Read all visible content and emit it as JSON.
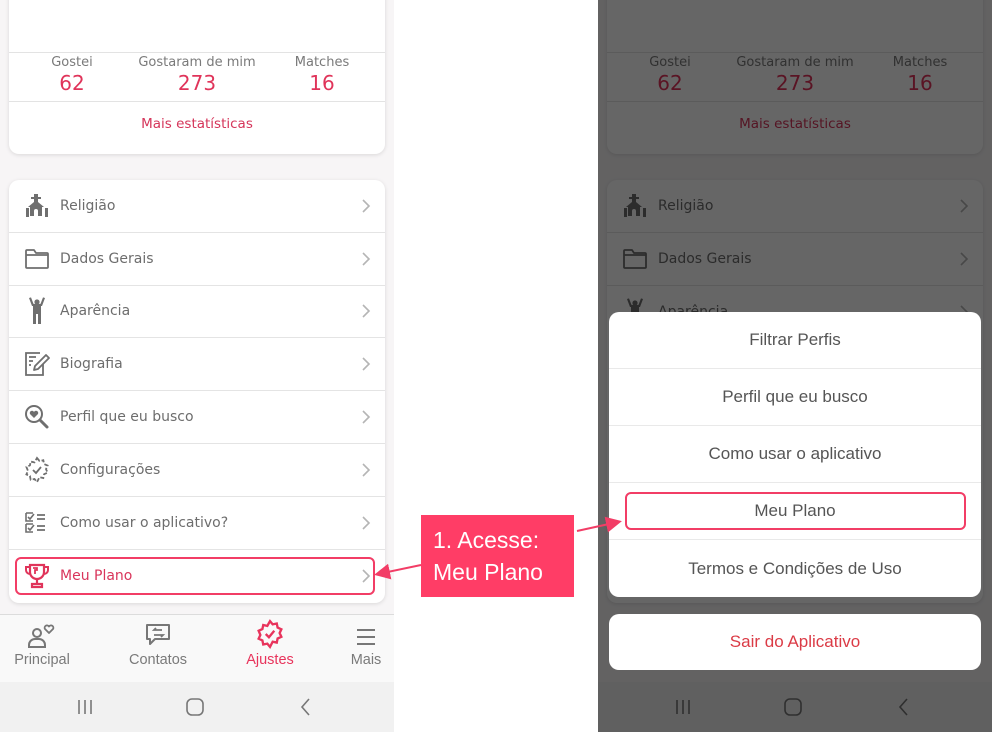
{
  "stats": {
    "items": [
      {
        "label": "Gostei",
        "value": "62"
      },
      {
        "label": "Gostaram de mim",
        "value": "273"
      },
      {
        "label": "Matches",
        "value": "16"
      }
    ],
    "more_link": "Mais estatísticas"
  },
  "settings_menu": {
    "items": [
      {
        "label": "Religião",
        "icon": "church-icon"
      },
      {
        "label": "Dados Gerais",
        "icon": "folder-icon"
      },
      {
        "label": "Aparência",
        "icon": "person-icon"
      },
      {
        "label": "Biografia",
        "icon": "edit-document-icon"
      },
      {
        "label": "Perfil que eu busco",
        "icon": "heart-search-icon"
      },
      {
        "label": "Configurações",
        "icon": "gear-check-icon"
      },
      {
        "label": "Como usar o aplicativo?",
        "icon": "checklist-icon"
      },
      {
        "label": "Meu Plano",
        "icon": "trophy-icon",
        "highlighted": true
      }
    ]
  },
  "tabbar": {
    "tabs": [
      {
        "label": "Principal",
        "icon": "user-heart-icon"
      },
      {
        "label": "Contatos",
        "icon": "chat-exchange-icon"
      },
      {
        "label": "Ajustes",
        "icon": "gear-check-icon",
        "active": true
      },
      {
        "label": "Mais",
        "icon": "menu-icon"
      }
    ]
  },
  "system_nav": {
    "buttons": [
      "recent-apps",
      "home",
      "back"
    ]
  },
  "action_sheet": {
    "items": [
      {
        "label": "Filtrar Perfis"
      },
      {
        "label": "Perfil que eu busco"
      },
      {
        "label": "Como usar o aplicativo"
      },
      {
        "label": "Meu Plano",
        "highlighted": true
      },
      {
        "label": "Termos e Condições de Uso"
      }
    ],
    "cancel_label": "Sair do Aplicativo"
  },
  "annotation": {
    "line1": "1. Acesse:",
    "line2": "Meu Plano"
  },
  "colors": {
    "accent": "#e0345a",
    "highlight": "#f23d66",
    "callout_bg": "#ff3d66",
    "exit_red": "#db3b46"
  }
}
